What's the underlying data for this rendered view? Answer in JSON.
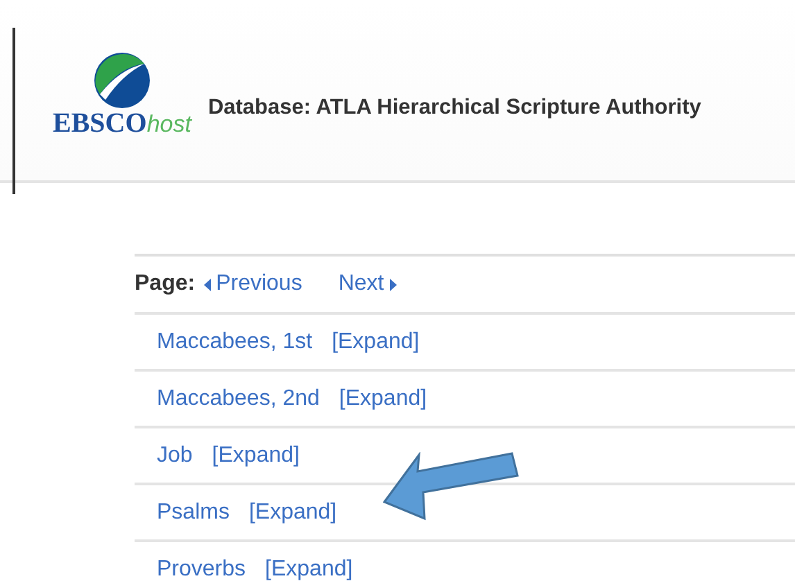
{
  "header": {
    "logo_text": "EBSCO",
    "logo_suffix": "host",
    "title": "Database: ATLA Hierarchical Scripture Authority"
  },
  "pager": {
    "label": "Page:",
    "previous": "Previous",
    "next": "Next"
  },
  "rows": [
    {
      "name": "Maccabees, 1st",
      "action": "[Expand]"
    },
    {
      "name": "Maccabees, 2nd",
      "action": "[Expand]"
    },
    {
      "name": "Job",
      "action": "[Expand]"
    },
    {
      "name": "Psalms",
      "action": "[Expand]"
    },
    {
      "name": "Proverbs",
      "action": "[Expand]"
    }
  ]
}
